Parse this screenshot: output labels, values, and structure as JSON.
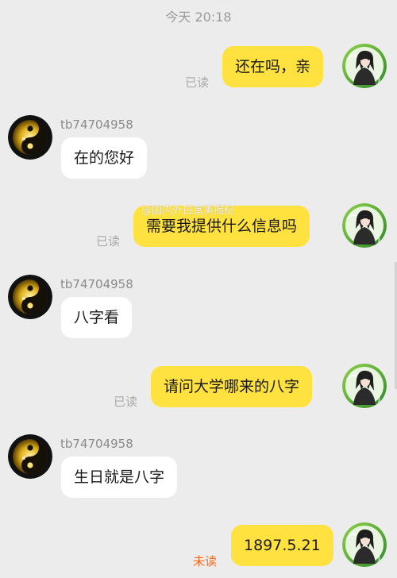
{
  "timestamp": "今天  20:18",
  "watermark": "@国内外白富美揭秘",
  "contact": {
    "name": "tb74704958"
  },
  "messages": [
    {
      "side": "out",
      "text": "还在吗，亲",
      "receipt": "已读"
    },
    {
      "side": "in",
      "text": "在的您好"
    },
    {
      "side": "out",
      "text": "需要我提供什么信息吗",
      "receipt": "已读"
    },
    {
      "side": "in",
      "text": "八字看"
    },
    {
      "side": "out",
      "text": "请问大学哪来的八字",
      "receipt": "已读"
    },
    {
      "side": "in",
      "text": "生日就是八字"
    },
    {
      "side": "out",
      "text": "1897.5.21",
      "receipt": "未读"
    }
  ],
  "colors": {
    "background": "#ececec",
    "outgoing_bubble": "#ffe23f",
    "incoming_bubble": "#ffffff",
    "read_receipt": "#a9a9a9",
    "unread_receipt": "#ff6a1a"
  },
  "icons": {
    "contact_avatar": "yin-yang-avatar-icon",
    "self_avatar": "anime-character-avatar-icon"
  }
}
